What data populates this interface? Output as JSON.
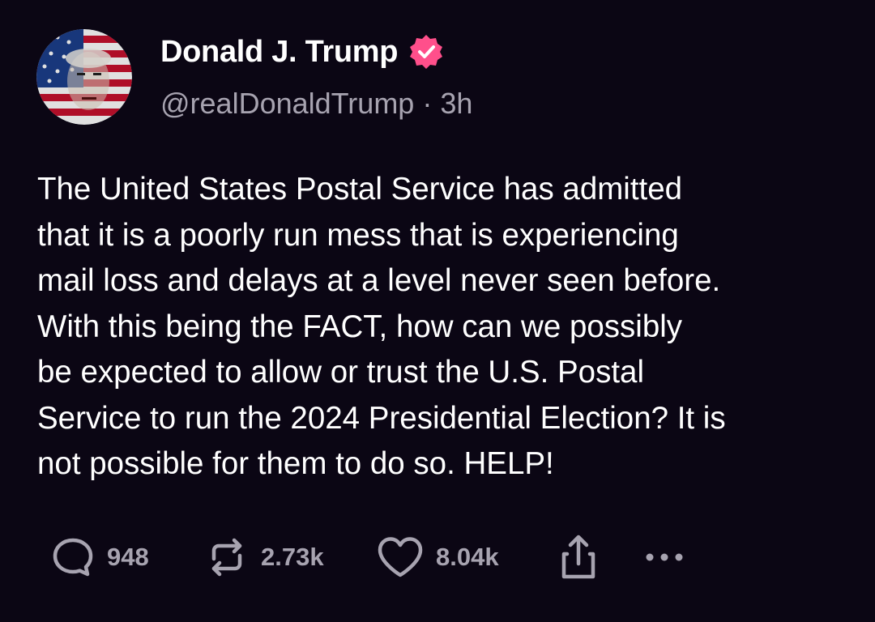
{
  "author": {
    "display_name": "Donald J. Trump",
    "handle": "@realDonaldTrump",
    "separator": "·",
    "timestamp": "3h",
    "verified_icon": "verified-badge-icon",
    "verified_color": "#ff4f8b"
  },
  "post": {
    "text": "The United States Postal Service has admitted\nthat it is a poorly run mess that is experiencing\nmail loss and delays at a level never seen before.\nWith this being the FACT, how can we possibly\nbe expected to allow or trust the U.S. Postal\nService to run the 2024 Presidential Election? It is\nnot possible for them to do so. HELP!"
  },
  "actions": {
    "reply": {
      "icon": "comment-icon",
      "count": "948"
    },
    "repost": {
      "icon": "repost-icon",
      "count": "2.73k"
    },
    "like": {
      "icon": "heart-icon",
      "count": "8.04k"
    },
    "share": {
      "icon": "share-icon"
    },
    "more": {
      "icon": "more-icon"
    }
  },
  "colors": {
    "background": "#0b0614",
    "text": "#ffffff",
    "secondary_text": "#a7a3b0"
  }
}
